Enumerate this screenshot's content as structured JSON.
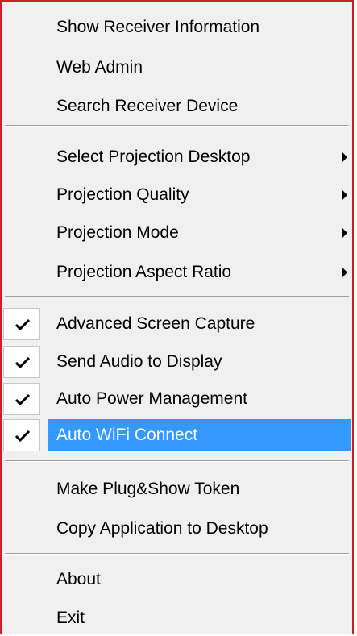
{
  "menu": {
    "items": [
      {
        "label": "Show Receiver Information"
      },
      {
        "label": "Web Admin"
      },
      {
        "label": "Search Receiver Device"
      },
      {
        "label": "Select Projection Desktop",
        "submenu": true
      },
      {
        "label": "Projection Quality",
        "submenu": true
      },
      {
        "label": "Projection Mode",
        "submenu": true
      },
      {
        "label": "Projection Aspect Ratio",
        "submenu": true
      },
      {
        "label": "Advanced Screen Capture",
        "checked": true
      },
      {
        "label": "Send Audio to Display",
        "checked": true
      },
      {
        "label": "Auto Power Management",
        "checked": true
      },
      {
        "label": "Auto WiFi Connect",
        "checked": true,
        "highlighted": true
      },
      {
        "label": "Make Plug&Show Token"
      },
      {
        "label": "Copy Application to Desktop"
      },
      {
        "label": "About"
      },
      {
        "label": "Exit"
      }
    ],
    "icons": {
      "checkmark": "checkmark-icon",
      "submenu_arrow": "submenu-arrow-icon"
    },
    "colors": {
      "menu_background": "#f0f0f0",
      "highlight": "#3399ff",
      "highlight_text": "#ffffff",
      "window_border": "#cc1f2a"
    }
  }
}
